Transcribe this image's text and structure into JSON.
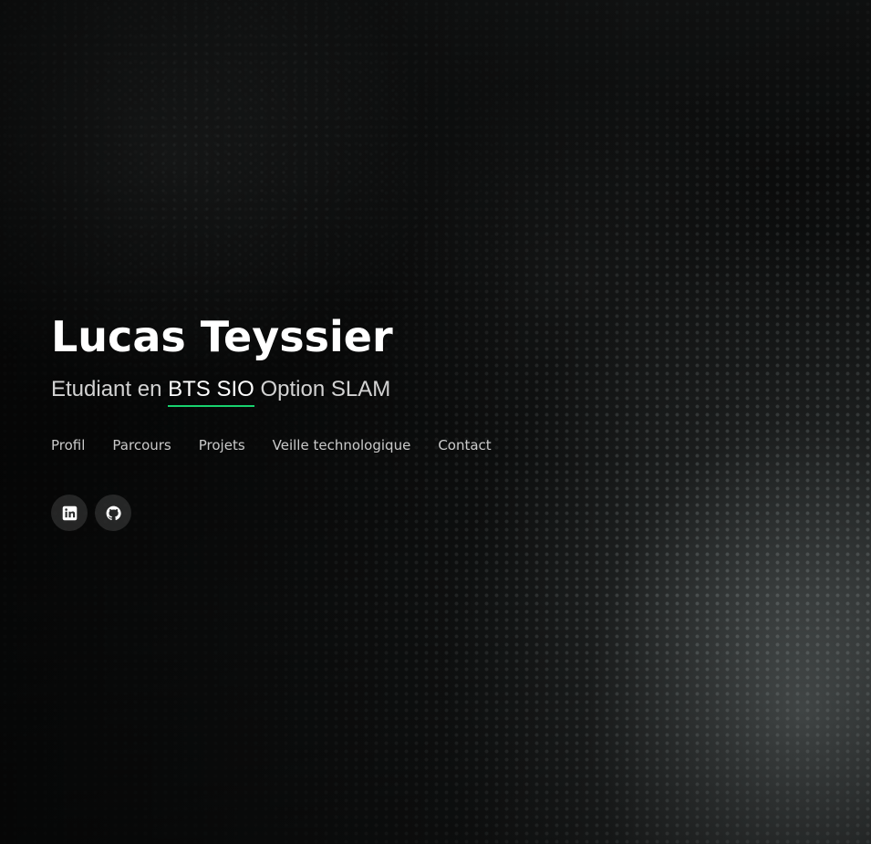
{
  "hero": {
    "name": "Lucas Teyssier",
    "subtitle_prefix": "Etudiant en ",
    "subtitle_highlight": "BTS SIO",
    "subtitle_suffix": " Option SLAM",
    "highlight_color": "#18d26e"
  },
  "nav": {
    "items": [
      {
        "label": "Profil"
      },
      {
        "label": "Parcours"
      },
      {
        "label": "Projets"
      },
      {
        "label": "Veille technologique"
      },
      {
        "label": "Contact"
      }
    ]
  },
  "social": {
    "items": [
      {
        "icon": "linkedin-icon"
      },
      {
        "icon": "github-icon"
      }
    ]
  }
}
